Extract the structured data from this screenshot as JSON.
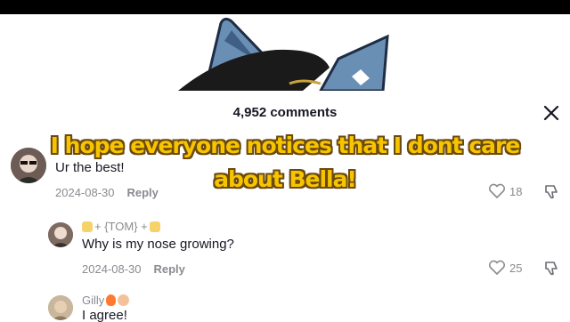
{
  "header": {
    "comments_count": "4,952 comments",
    "close_icon": "close-icon"
  },
  "caption": {
    "line1": "I hope everyone notices that I dont care",
    "line2": "about Bella!"
  },
  "comments": [
    {
      "username": "",
      "text": "Ur the best!",
      "date": "2024-08-30",
      "reply_label": "Reply",
      "likes": "18"
    },
    {
      "username": "+ {TOM} +",
      "text": "Why is my nose growing?",
      "date": "2024-08-30",
      "reply_label": "Reply",
      "likes": "25"
    },
    {
      "username": "Gilly",
      "text": "I agree!"
    }
  ],
  "colors": {
    "caption_fill": "#f7c400",
    "caption_outline": "#6b4a10",
    "muted": "#8a8b91",
    "text": "#161823"
  }
}
